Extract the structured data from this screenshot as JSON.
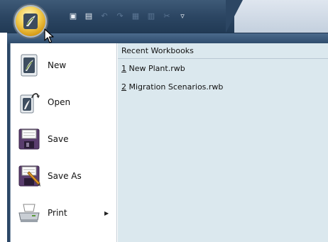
{
  "qat": {
    "buttons": [
      {
        "name": "open-icon",
        "glyph": "▣",
        "state": "active"
      },
      {
        "name": "save-icon",
        "glyph": "▤",
        "state": "active"
      },
      {
        "name": "undo-icon",
        "glyph": "↶",
        "state": "disabled"
      },
      {
        "name": "redo-icon",
        "glyph": "↷",
        "state": "disabled"
      },
      {
        "name": "copy-icon",
        "glyph": "▦",
        "state": "disabled"
      },
      {
        "name": "paste-icon",
        "glyph": "▥",
        "state": "disabled"
      },
      {
        "name": "cut-icon",
        "glyph": "✂",
        "state": "disabled"
      },
      {
        "name": "customize-dropdown-icon",
        "glyph": "▿",
        "state": "active"
      }
    ]
  },
  "menu": {
    "commands": [
      {
        "label": "New",
        "icon": "new-document-icon"
      },
      {
        "label": "Open",
        "icon": "open-icon"
      },
      {
        "label": "Save",
        "icon": "save-icon"
      },
      {
        "label": "Save As",
        "icon": "save-as-icon"
      },
      {
        "label": "Print",
        "icon": "print-icon",
        "submenu": true
      }
    ],
    "recent": {
      "header": "Recent Workbooks",
      "items": [
        {
          "num": "1",
          "name": " New Plant.rwb"
        },
        {
          "num": "2",
          "name": " Migration Scenarios.rwb"
        }
      ]
    }
  },
  "colors": {
    "title_bar": "#2c4663",
    "orb": "#f4cf54",
    "recent_panel": "#dbe8ee"
  }
}
